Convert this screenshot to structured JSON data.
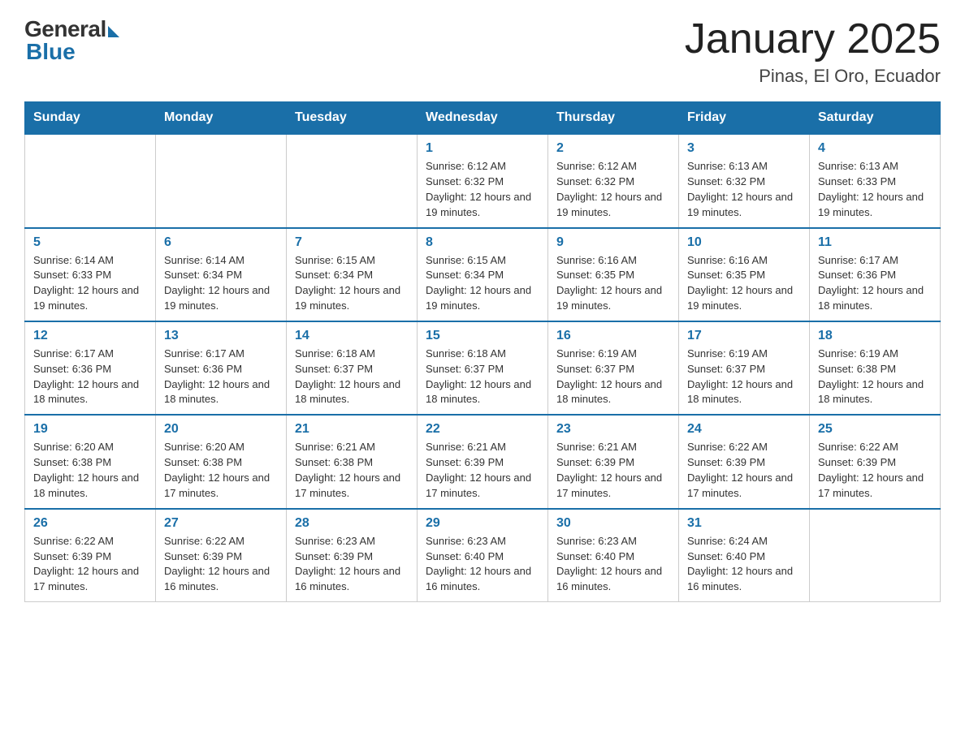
{
  "header": {
    "logo_general": "General",
    "logo_blue": "Blue",
    "month_title": "January 2025",
    "location": "Pinas, El Oro, Ecuador"
  },
  "days_of_week": [
    "Sunday",
    "Monday",
    "Tuesday",
    "Wednesday",
    "Thursday",
    "Friday",
    "Saturday"
  ],
  "weeks": [
    [
      {
        "day": "",
        "info": ""
      },
      {
        "day": "",
        "info": ""
      },
      {
        "day": "",
        "info": ""
      },
      {
        "day": "1",
        "info": "Sunrise: 6:12 AM\nSunset: 6:32 PM\nDaylight: 12 hours and 19 minutes."
      },
      {
        "day": "2",
        "info": "Sunrise: 6:12 AM\nSunset: 6:32 PM\nDaylight: 12 hours and 19 minutes."
      },
      {
        "day": "3",
        "info": "Sunrise: 6:13 AM\nSunset: 6:32 PM\nDaylight: 12 hours and 19 minutes."
      },
      {
        "day": "4",
        "info": "Sunrise: 6:13 AM\nSunset: 6:33 PM\nDaylight: 12 hours and 19 minutes."
      }
    ],
    [
      {
        "day": "5",
        "info": "Sunrise: 6:14 AM\nSunset: 6:33 PM\nDaylight: 12 hours and 19 minutes."
      },
      {
        "day": "6",
        "info": "Sunrise: 6:14 AM\nSunset: 6:34 PM\nDaylight: 12 hours and 19 minutes."
      },
      {
        "day": "7",
        "info": "Sunrise: 6:15 AM\nSunset: 6:34 PM\nDaylight: 12 hours and 19 minutes."
      },
      {
        "day": "8",
        "info": "Sunrise: 6:15 AM\nSunset: 6:34 PM\nDaylight: 12 hours and 19 minutes."
      },
      {
        "day": "9",
        "info": "Sunrise: 6:16 AM\nSunset: 6:35 PM\nDaylight: 12 hours and 19 minutes."
      },
      {
        "day": "10",
        "info": "Sunrise: 6:16 AM\nSunset: 6:35 PM\nDaylight: 12 hours and 19 minutes."
      },
      {
        "day": "11",
        "info": "Sunrise: 6:17 AM\nSunset: 6:36 PM\nDaylight: 12 hours and 18 minutes."
      }
    ],
    [
      {
        "day": "12",
        "info": "Sunrise: 6:17 AM\nSunset: 6:36 PM\nDaylight: 12 hours and 18 minutes."
      },
      {
        "day": "13",
        "info": "Sunrise: 6:17 AM\nSunset: 6:36 PM\nDaylight: 12 hours and 18 minutes."
      },
      {
        "day": "14",
        "info": "Sunrise: 6:18 AM\nSunset: 6:37 PM\nDaylight: 12 hours and 18 minutes."
      },
      {
        "day": "15",
        "info": "Sunrise: 6:18 AM\nSunset: 6:37 PM\nDaylight: 12 hours and 18 minutes."
      },
      {
        "day": "16",
        "info": "Sunrise: 6:19 AM\nSunset: 6:37 PM\nDaylight: 12 hours and 18 minutes."
      },
      {
        "day": "17",
        "info": "Sunrise: 6:19 AM\nSunset: 6:37 PM\nDaylight: 12 hours and 18 minutes."
      },
      {
        "day": "18",
        "info": "Sunrise: 6:19 AM\nSunset: 6:38 PM\nDaylight: 12 hours and 18 minutes."
      }
    ],
    [
      {
        "day": "19",
        "info": "Sunrise: 6:20 AM\nSunset: 6:38 PM\nDaylight: 12 hours and 18 minutes."
      },
      {
        "day": "20",
        "info": "Sunrise: 6:20 AM\nSunset: 6:38 PM\nDaylight: 12 hours and 17 minutes."
      },
      {
        "day": "21",
        "info": "Sunrise: 6:21 AM\nSunset: 6:38 PM\nDaylight: 12 hours and 17 minutes."
      },
      {
        "day": "22",
        "info": "Sunrise: 6:21 AM\nSunset: 6:39 PM\nDaylight: 12 hours and 17 minutes."
      },
      {
        "day": "23",
        "info": "Sunrise: 6:21 AM\nSunset: 6:39 PM\nDaylight: 12 hours and 17 minutes."
      },
      {
        "day": "24",
        "info": "Sunrise: 6:22 AM\nSunset: 6:39 PM\nDaylight: 12 hours and 17 minutes."
      },
      {
        "day": "25",
        "info": "Sunrise: 6:22 AM\nSunset: 6:39 PM\nDaylight: 12 hours and 17 minutes."
      }
    ],
    [
      {
        "day": "26",
        "info": "Sunrise: 6:22 AM\nSunset: 6:39 PM\nDaylight: 12 hours and 17 minutes."
      },
      {
        "day": "27",
        "info": "Sunrise: 6:22 AM\nSunset: 6:39 PM\nDaylight: 12 hours and 16 minutes."
      },
      {
        "day": "28",
        "info": "Sunrise: 6:23 AM\nSunset: 6:39 PM\nDaylight: 12 hours and 16 minutes."
      },
      {
        "day": "29",
        "info": "Sunrise: 6:23 AM\nSunset: 6:40 PM\nDaylight: 12 hours and 16 minutes."
      },
      {
        "day": "30",
        "info": "Sunrise: 6:23 AM\nSunset: 6:40 PM\nDaylight: 12 hours and 16 minutes."
      },
      {
        "day": "31",
        "info": "Sunrise: 6:24 AM\nSunset: 6:40 PM\nDaylight: 12 hours and 16 minutes."
      },
      {
        "day": "",
        "info": ""
      }
    ]
  ]
}
